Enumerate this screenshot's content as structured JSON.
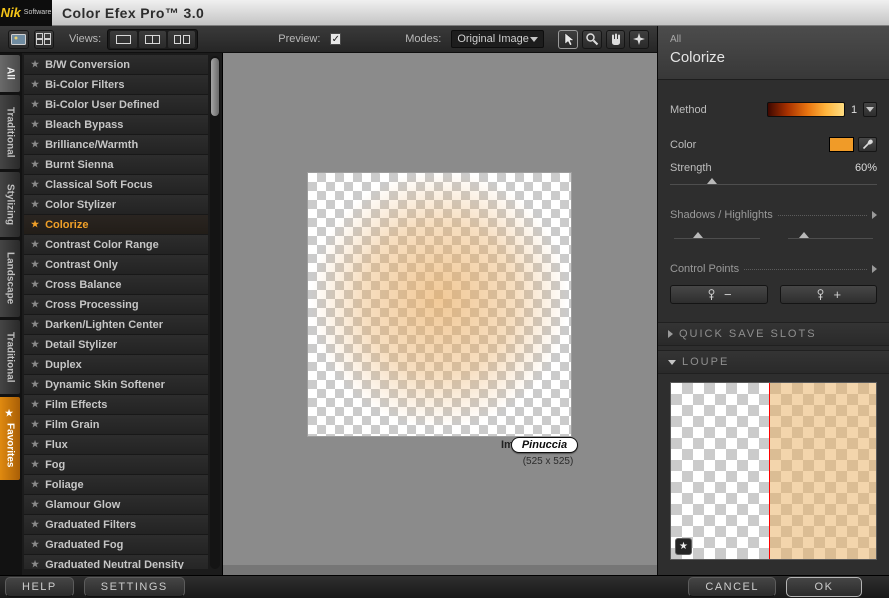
{
  "titlebar": {
    "logo_main": "Nik",
    "logo_sub": "Software",
    "title": "Color Efex Pro™ 3.0"
  },
  "toolbar": {
    "views_label": "Views:",
    "preview_label": "Preview:",
    "preview_check": "✓",
    "modes_label": "Modes:",
    "mode_value": "Original Image"
  },
  "category_tabs": {
    "items": [
      {
        "label": "All",
        "active": true,
        "favorite": false
      },
      {
        "label": "Traditional",
        "active": false,
        "favorite": false
      },
      {
        "label": "Stylizing",
        "active": false,
        "favorite": false
      },
      {
        "label": "Landscape",
        "active": false,
        "favorite": false
      },
      {
        "label": "Traditional",
        "active": false,
        "favorite": false
      },
      {
        "label": "Favorites",
        "active": false,
        "favorite": true
      }
    ]
  },
  "filters": {
    "selected": "Colorize",
    "items": [
      "B/W Conversion",
      "Bi-Color Filters",
      "Bi-Color User Defined",
      "Bleach Bypass",
      "Brilliance/Warmth",
      "Burnt Sienna",
      "Classical Soft Focus",
      "Color Stylizer",
      "Colorize",
      "Contrast Color Range",
      "Contrast Only",
      "Cross Balance",
      "Cross Processing",
      "Darken/Lighten Center",
      "Detail Stylizer",
      "Duplex",
      "Dynamic Skin Softener",
      "Film Effects",
      "Film Grain",
      "Flux",
      "Fog",
      "Foliage",
      "Glamour Glow",
      "Graduated Filters",
      "Graduated Fog",
      "Graduated Neutral Density"
    ]
  },
  "canvas": {
    "image_label_prefix": "Im",
    "badge_text": "Pinuccia",
    "image_size": "(525 x 525)"
  },
  "panel": {
    "category": "All",
    "filter_title": "Colorize",
    "method_label": "Method",
    "method_value": "1",
    "color_label": "Color",
    "strength_label": "Strength",
    "strength_value": "60%",
    "shadows_highlights_label": "Shadows / Highlights",
    "control_points_label": "Control Points",
    "cp_minus": "−",
    "cp_plus": "+",
    "quick_save_label": "QUICK SAVE SLOTS",
    "loupe_label": "LOUPE",
    "loupe_star": "★"
  },
  "footer": {
    "help_label": "HELP",
    "settings_label": "SETTINGS",
    "cancel_label": "CANCEL",
    "ok_label": "OK"
  },
  "colors": {
    "accent_orange": "#f0a028",
    "swatch_orange": "#f09b28",
    "loupe_split_line": "#ff0000"
  }
}
